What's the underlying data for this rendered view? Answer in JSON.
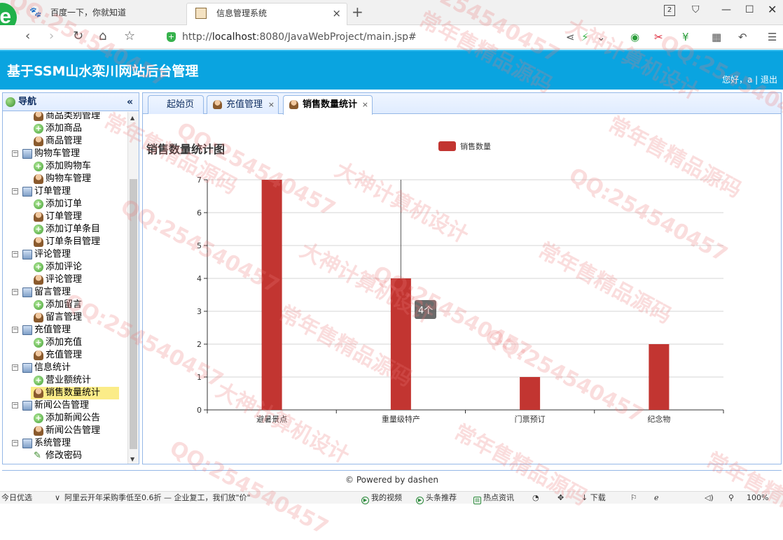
{
  "browser": {
    "tabs": [
      {
        "title": "百度一下，你就知道",
        "icon": "paw-icon"
      },
      {
        "title": "信息管理系统",
        "icon": "page-icon",
        "close": "×"
      }
    ],
    "newtab": "+",
    "tab_count": "2",
    "url_protocol": "http://",
    "url_host": "localhost",
    "url_rest": ":8080/JavaWebProject/main.jsp#"
  },
  "app": {
    "title": "基于SSM山水栾川网站后台管理",
    "userinfo": "您好，a | 退出"
  },
  "nav": {
    "header": "导航",
    "collapse": "«",
    "tree": [
      {
        "label": "商品类别管理",
        "type": "leaf",
        "icon": "user-icon"
      },
      {
        "label": "添加商品",
        "type": "leaf",
        "icon": "add-icon"
      },
      {
        "label": "商品管理",
        "type": "leaf",
        "icon": "user-icon"
      },
      {
        "label": "购物车管理",
        "type": "folder",
        "icon": "folder-icon"
      },
      {
        "label": "添加购物车",
        "type": "leaf",
        "icon": "add-icon"
      },
      {
        "label": "购物车管理",
        "type": "leaf",
        "icon": "user-icon"
      },
      {
        "label": "订单管理",
        "type": "folder",
        "icon": "folder-icon"
      },
      {
        "label": "添加订单",
        "type": "leaf",
        "icon": "add-icon"
      },
      {
        "label": "订单管理",
        "type": "leaf",
        "icon": "user-icon"
      },
      {
        "label": "添加订单条目",
        "type": "leaf",
        "icon": "add-icon"
      },
      {
        "label": "订单条目管理",
        "type": "leaf",
        "icon": "user-icon"
      },
      {
        "label": "评论管理",
        "type": "folder",
        "icon": "folder-icon"
      },
      {
        "label": "添加评论",
        "type": "leaf",
        "icon": "add-icon"
      },
      {
        "label": "评论管理",
        "type": "leaf",
        "icon": "user-icon"
      },
      {
        "label": "留言管理",
        "type": "folder",
        "icon": "folder-icon"
      },
      {
        "label": "添加留言",
        "type": "leaf",
        "icon": "add-icon"
      },
      {
        "label": "留言管理",
        "type": "leaf",
        "icon": "user-icon"
      },
      {
        "label": "充值管理",
        "type": "folder",
        "icon": "folder-icon"
      },
      {
        "label": "添加充值",
        "type": "leaf",
        "icon": "add-icon"
      },
      {
        "label": "充值管理",
        "type": "leaf",
        "icon": "user-icon"
      },
      {
        "label": "信息统计",
        "type": "folder",
        "icon": "folder-icon"
      },
      {
        "label": "营业额统计",
        "type": "leaf",
        "icon": "add-icon"
      },
      {
        "label": "销售数量统计",
        "type": "leaf",
        "icon": "user-icon",
        "selected": true
      },
      {
        "label": "新闻公告管理",
        "type": "folder",
        "icon": "folder-icon"
      },
      {
        "label": "添加新闻公告",
        "type": "leaf",
        "icon": "add-icon"
      },
      {
        "label": "新闻公告管理",
        "type": "leaf",
        "icon": "user-icon"
      },
      {
        "label": "系统管理",
        "type": "folder",
        "icon": "folder-icon"
      },
      {
        "label": "修改密码",
        "type": "leaf",
        "icon": "pencil-icon"
      }
    ]
  },
  "content_tabs": [
    {
      "label": "起始页",
      "closable": false,
      "active": false
    },
    {
      "label": "充值管理",
      "closable": true,
      "active": false
    },
    {
      "label": "销售数量统计",
      "closable": true,
      "active": true
    }
  ],
  "chart_data": {
    "type": "bar",
    "title": "销售数量统计图",
    "categories": [
      "避暑景点",
      "重量级特产",
      "门票预订",
      "纪念物"
    ],
    "series": [
      {
        "name": "销售数量",
        "values": [
          7,
          4,
          1,
          2
        ],
        "color": "#c23531"
      }
    ],
    "ylim": [
      0,
      7
    ],
    "yticks": [
      0,
      1,
      2,
      3,
      4,
      5,
      6,
      7
    ],
    "legend": "top-center",
    "grid": true,
    "tooltip": {
      "category": "重量级特产",
      "text": "4个"
    }
  },
  "footer": "© Powered by dashen",
  "statusbar": {
    "left": "今日优选",
    "news": "阿里云开年采购季低至0.6折 — 企业复工，我们放\"价\"",
    "items": [
      "我的视频",
      "头条推荐",
      "热点资讯",
      "下载"
    ],
    "zoom": "100%"
  },
  "watermarks": [
    "QQ:254540457",
    "大神计算机设计",
    "常年售精品源码"
  ],
  "colors": {
    "header": "#0aa4e0",
    "bar": "#c23531",
    "panel_border": "#95b8e7"
  }
}
